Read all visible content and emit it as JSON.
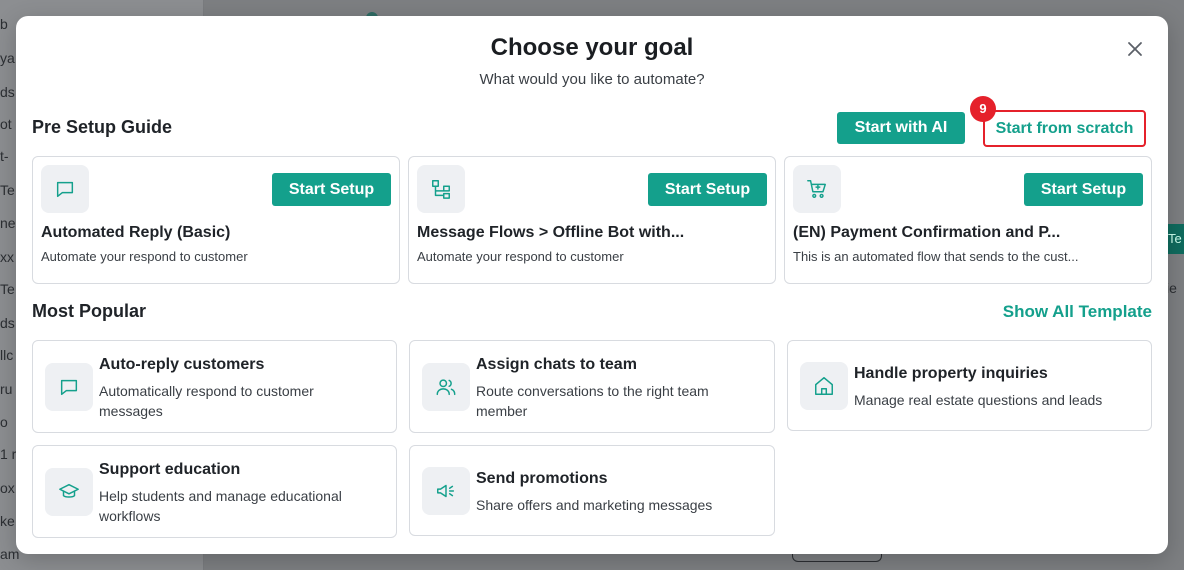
{
  "background": {
    "sidebar_fragments": [
      "b",
      "ya",
      "ds",
      "ot",
      "t-",
      "Te",
      "ne",
      "xx",
      "Te",
      "ds",
      "llc",
      "ru",
      "o",
      "1 r",
      "ox",
      "ke",
      "am"
    ],
    "right_fragments": [
      "Te",
      "ie"
    ]
  },
  "modal": {
    "title": "Choose your goal",
    "subtitle": "What would you like to automate?",
    "close_icon": "close-icon"
  },
  "pre_setup": {
    "title": "Pre Setup Guide",
    "start_ai_label": "Start with AI",
    "start_scratch_label": "Start from scratch",
    "step_badge": "9",
    "cards": [
      {
        "icon": "message-square-icon",
        "button": "Start Setup",
        "title": "Automated Reply (Basic)",
        "desc": "Automate your respond to customer"
      },
      {
        "icon": "flow-icon",
        "button": "Start Setup",
        "title": "Message Flows > Offline Bot with...",
        "desc": "Automate your respond to customer"
      },
      {
        "icon": "cart-icon",
        "button": "Start Setup",
        "title": "(EN) Payment Confirmation and P...",
        "desc": "This is an automated flow that sends to the cust..."
      }
    ]
  },
  "most_popular": {
    "title": "Most Popular",
    "show_all_label": "Show All Template",
    "cards": [
      {
        "icon": "message-square-icon",
        "title": "Auto-reply customers",
        "desc": "Automatically respond to customer messages"
      },
      {
        "icon": "users-icon",
        "title": "Assign chats to team",
        "desc": "Route conversations to the right team member"
      },
      {
        "icon": "home-icon",
        "title": "Handle property inquiries",
        "desc": "Manage real estate questions and leads"
      },
      {
        "icon": "graduation-cap-icon",
        "title": "Support education",
        "desc": "Help students and manage educational workflows"
      },
      {
        "icon": "megaphone-icon",
        "title": "Send promotions",
        "desc": "Share offers and marketing messages"
      }
    ]
  },
  "colors": {
    "accent": "#14a08c",
    "highlight": "#e5212b",
    "overlay": "#7d7f82"
  }
}
